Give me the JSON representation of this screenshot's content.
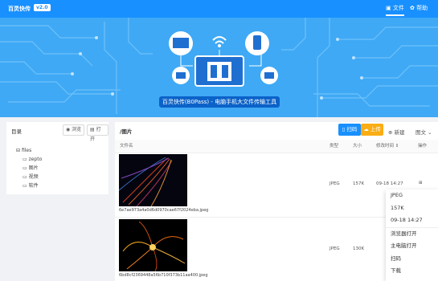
{
  "header": {
    "brand": "百灵快传",
    "version": "v2.0",
    "nav_files": "文件",
    "nav_help": "帮助"
  },
  "hero": {
    "tagline": "百灵快传(B0Pass) - 电脑手机大文件传输工具"
  },
  "sidebar": {
    "title": "目录",
    "browse": "浏览",
    "open": "打开",
    "tree": [
      "files",
      "zepto",
      "图片",
      "视频",
      "软件"
    ]
  },
  "main": {
    "path": "/图片",
    "scan_label": "扫码",
    "upload_label": "上传",
    "new_label": "新建",
    "view_label": "图文",
    "columns": {
      "name": "文件名",
      "type": "类型",
      "size": "大小",
      "mtime": "修改时间",
      "ops": "操作"
    },
    "rows": [
      {
        "name": "6e7ae973a4a0d6d0970cae67f2024eba.jpeg",
        "type": "JPEG",
        "size": "157K",
        "mtime": "09-18 14:27"
      },
      {
        "name": "6bd8cf2369448a56b710f373b11aa400.jpeg",
        "type": "JPEG",
        "size": "130K",
        "mtime": ""
      }
    ]
  },
  "context_menu": [
    "JPEG",
    "157K",
    "09-18 14:27",
    "浏览器打开",
    "主电脑打开",
    "扫码",
    "下载"
  ],
  "colors": {
    "primary": "#1890ff",
    "upload": "#faad14",
    "hero": "#3fa9f5",
    "tagline_bg": "#0b62c8"
  }
}
